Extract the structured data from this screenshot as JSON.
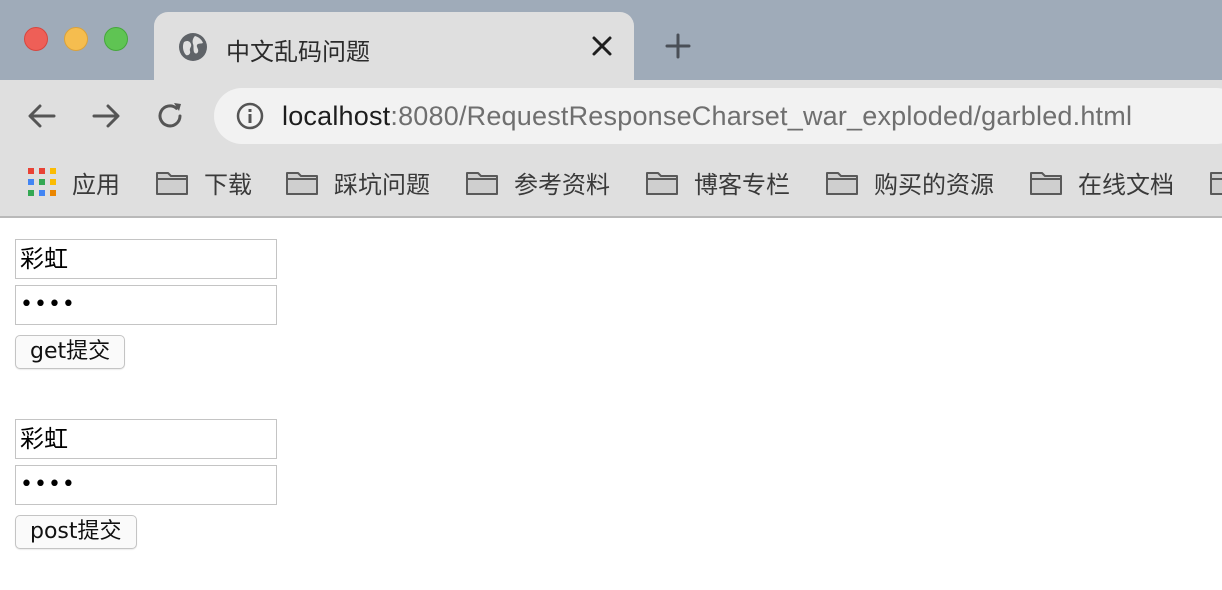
{
  "tab": {
    "title": "中文乱码问题"
  },
  "address_bar": {
    "host": "localhost",
    "path": ":8080/RequestResponseCharset_war_exploded/garbled.html"
  },
  "bookmarks": {
    "apps_label": "应用",
    "items": [
      {
        "label": "下载"
      },
      {
        "label": "踩坑问题"
      },
      {
        "label": "参考资料"
      },
      {
        "label": "博客专栏"
      },
      {
        "label": "购买的资源"
      },
      {
        "label": "在线文档"
      }
    ]
  },
  "forms": {
    "get_form": {
      "username_value": "彩虹",
      "password_masked": "••••",
      "submit_label": "get提交"
    },
    "post_form": {
      "username_value": "彩虹",
      "password_masked": "••••",
      "submit_label": "post提交"
    }
  },
  "colors": {
    "titlebar": "#9fabb9",
    "toolbar": "#dfdfdf",
    "close": "#ee5f57",
    "minimize": "#f5bd4f",
    "maximize": "#5fc453"
  }
}
